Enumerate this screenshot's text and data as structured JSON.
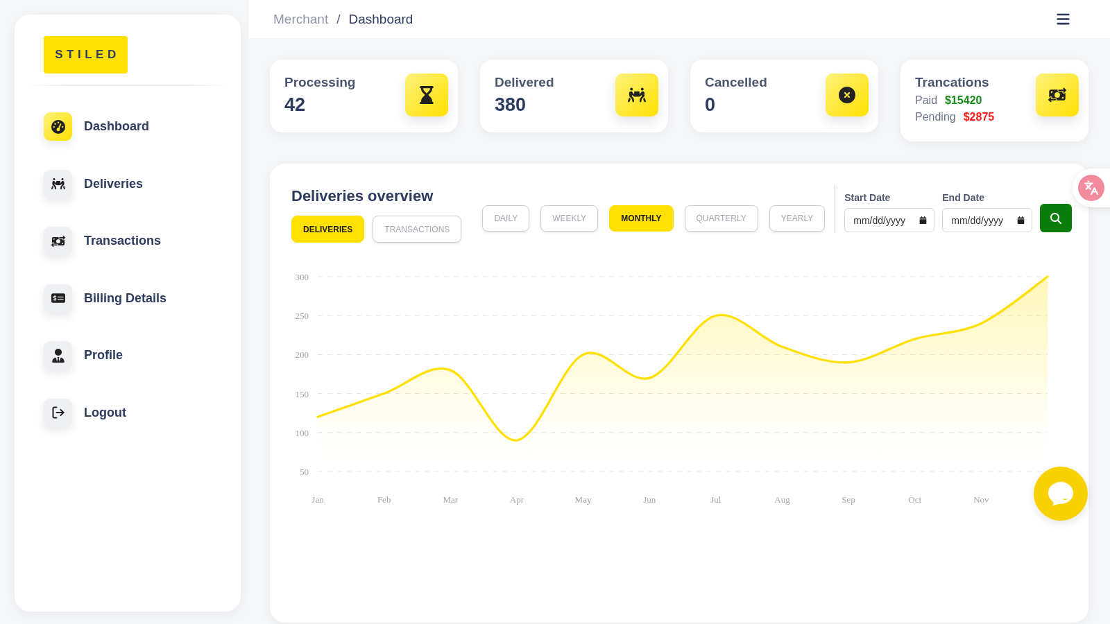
{
  "sidebar": {
    "logo": "STILED",
    "items": [
      {
        "label": "Dashboard",
        "selected": true
      },
      {
        "label": "Deliveries",
        "selected": false
      },
      {
        "label": "Transactions",
        "selected": false
      },
      {
        "label": "Billing Details",
        "selected": false
      },
      {
        "label": "Profile",
        "selected": false
      },
      {
        "label": "Logout",
        "selected": false
      }
    ]
  },
  "breadcrumb": {
    "items": [
      "Merchant",
      "Dashboard"
    ],
    "separator": "/"
  },
  "stats": [
    {
      "kind": "count",
      "title": "Processing",
      "value": "42"
    },
    {
      "kind": "count",
      "title": "Delivered",
      "value": "380"
    },
    {
      "kind": "count",
      "title": "Cancelled",
      "value": "0"
    },
    {
      "kind": "payments",
      "title": "Trancations",
      "lines": [
        {
          "label": "Paid",
          "amount": "$15420",
          "color": "#178c17"
        },
        {
          "label": "Pending",
          "amount": "$2875",
          "color": "#ff1a1a"
        }
      ]
    }
  ],
  "overview": {
    "title": "Deliveries overview",
    "datasets": [
      {
        "label": "DELIVERIES",
        "selected": true
      },
      {
        "label": "TRANSACTIONS",
        "selected": false
      }
    ],
    "periods": [
      {
        "label": "DAILY",
        "selected": false
      },
      {
        "label": "WEEKLY",
        "selected": false
      },
      {
        "label": "MONTHLY",
        "selected": true
      },
      {
        "label": "QUARTERLY",
        "selected": false
      },
      {
        "label": "YEARLY",
        "selected": false
      }
    ],
    "date_fields": [
      {
        "label": "Start Date",
        "placeholder": "mm/dd/yyyy"
      },
      {
        "label": "End Date",
        "placeholder": "mm/dd/yyyy"
      }
    ],
    "chart_data": [
      {
        "type": "area",
        "categories": [
          "Jan",
          "Feb",
          "Mar",
          "Apr",
          "May",
          "Jun",
          "Jul",
          "Aug",
          "Sep",
          "Oct",
          "Nov",
          null
        ],
        "values": [
          120,
          150,
          180,
          90,
          200,
          170,
          250,
          210,
          190,
          220,
          240,
          300
        ],
        "color": "#ffe000",
        "yticks": [
          50,
          100,
          150,
          200,
          250,
          300
        ],
        "ylim": [
          50,
          300
        ],
        "grid": true
      }
    ]
  }
}
